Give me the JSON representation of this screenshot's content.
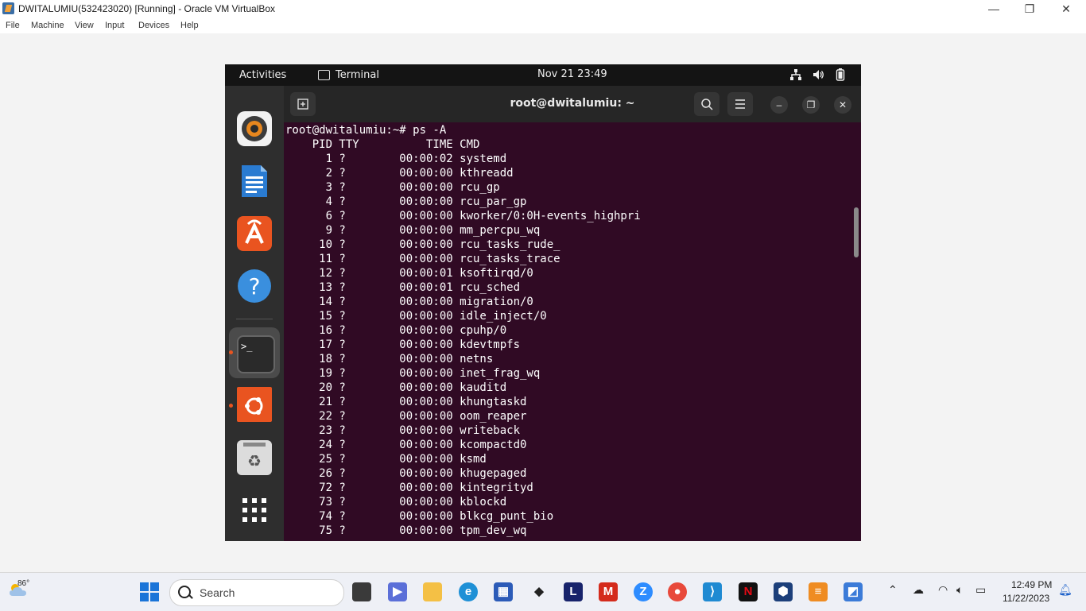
{
  "host": {
    "title": "DWITALUMIU(532423020) [Running] - Oracle VM VirtualBox",
    "menu": [
      "File",
      "Machine",
      "View",
      "Input",
      "Devices",
      "Help"
    ],
    "window_controls": {
      "minimize": "—",
      "restore": "❐",
      "close": "✕"
    }
  },
  "vm": {
    "topbar": {
      "activities": "Activities",
      "app_label": "Terminal",
      "clock": "Nov 21  23:49"
    },
    "dock": {
      "apps": [
        "rhythmbox-icon",
        "libreoffice-writer-icon",
        "app-center-icon",
        "help-icon",
        "terminal-icon",
        "ubuntu-icon",
        "trash-icon",
        "app-grid-icon"
      ]
    },
    "terminal": {
      "title": "root@dwitalumiu: ~",
      "lines": [
        "root@dwitalumiu:~# ps -A",
        "    PID TTY          TIME CMD",
        "      1 ?        00:00:02 systemd",
        "      2 ?        00:00:00 kthreadd",
        "      3 ?        00:00:00 rcu_gp",
        "      4 ?        00:00:00 rcu_par_gp",
        "      6 ?        00:00:00 kworker/0:0H-events_highpri",
        "      9 ?        00:00:00 mm_percpu_wq",
        "     10 ?        00:00:00 rcu_tasks_rude_",
        "     11 ?        00:00:00 rcu_tasks_trace",
        "     12 ?        00:00:01 ksoftirqd/0",
        "     13 ?        00:00:01 rcu_sched",
        "     14 ?        00:00:00 migration/0",
        "     15 ?        00:00:00 idle_inject/0",
        "     16 ?        00:00:00 cpuhp/0",
        "     17 ?        00:00:00 kdevtmpfs",
        "     18 ?        00:00:00 netns",
        "     19 ?        00:00:00 inet_frag_wq",
        "     20 ?        00:00:00 kauditd",
        "     21 ?        00:00:00 khungtaskd",
        "     22 ?        00:00:00 oom_reaper",
        "     23 ?        00:00:00 writeback",
        "     24 ?        00:00:00 kcompactd0",
        "     25 ?        00:00:00 ksmd",
        "     26 ?        00:00:00 khugepaged",
        "     72 ?        00:00:00 kintegrityd",
        "     73 ?        00:00:00 kblockd",
        "     74 ?        00:00:00 blkcg_punt_bio",
        "     75 ?        00:00:00 tpm_dev_wq"
      ]
    }
  },
  "taskbar": {
    "weather_temp": "86°",
    "search_placeholder": "Search",
    "time": "12:49 PM",
    "date": "11/22/2023"
  },
  "colors": {
    "terminal_bg": "#300a24",
    "ubuntu_orange": "#e95420",
    "windows_blue": "#1a74d8"
  }
}
